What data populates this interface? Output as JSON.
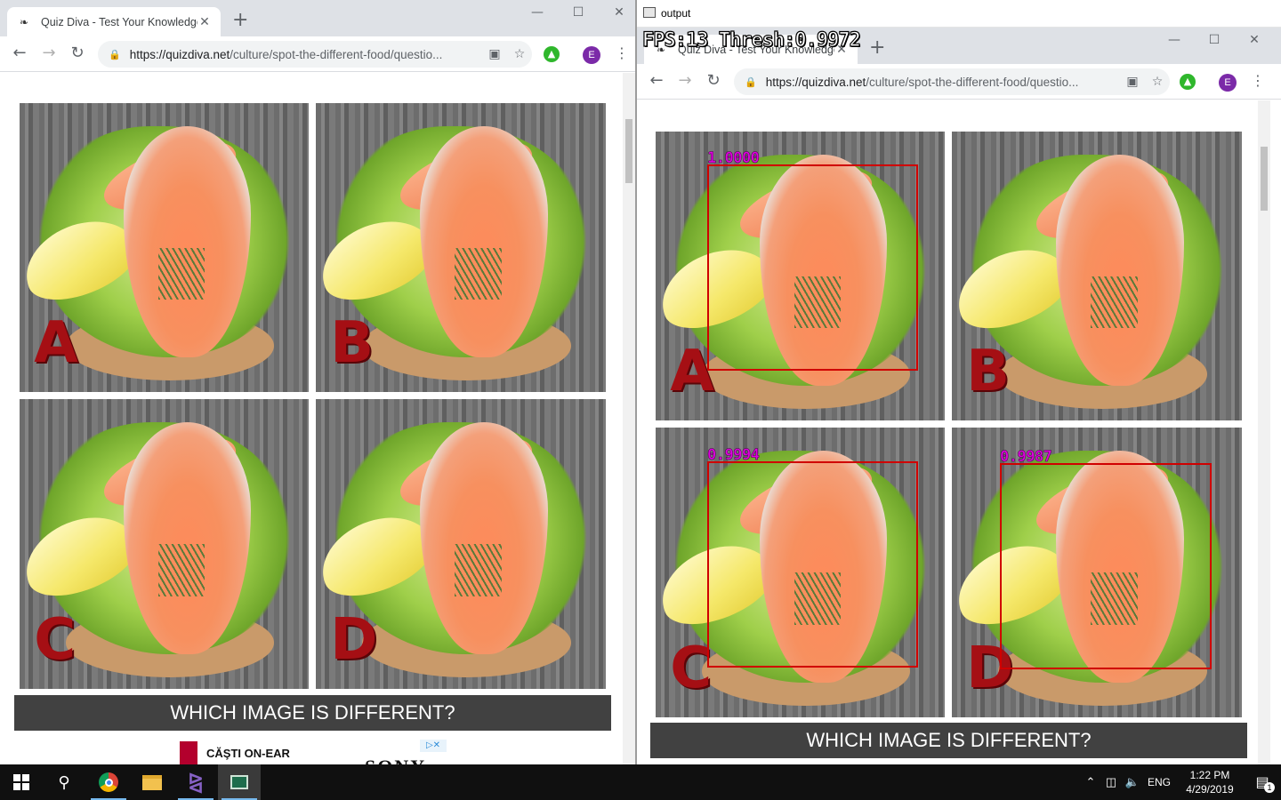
{
  "left_browser": {
    "tab_title": "Quiz Diva - Test Your Knowledge",
    "favicon": "quizdiva-icon",
    "url_host": "https://quizdiva.net",
    "url_path": "/culture/spot-the-different-food/questio...",
    "profile_initial": "E",
    "tiles": [
      {
        "letter": "A"
      },
      {
        "letter": "B"
      },
      {
        "letter": "C"
      },
      {
        "letter": "D"
      }
    ],
    "question": "WHICH IMAGE IS DIFFERENT?",
    "ad": {
      "label": "CĂŞTI ON-EAR",
      "brand_partial": "SONY"
    }
  },
  "output_window": {
    "title": "output",
    "hud": "FPS:13  Thresh:0.9972",
    "tab_title": "Quiz Diva - Test Your Knowledge",
    "url_host": "https://quizdiva.net",
    "url_path": "/culture/spot-the-different-food/questio...",
    "profile_initial": "E",
    "tiles": [
      {
        "letter": "A",
        "score": "1.0000"
      },
      {
        "letter": "B",
        "score": ""
      },
      {
        "letter": "C",
        "score": "0.9994"
      },
      {
        "letter": "D",
        "score": "0.9987"
      }
    ],
    "question": "WHICH IMAGE IS DIFFERENT?"
  },
  "taskbar": {
    "apps": [
      "start-icon",
      "search-icon",
      "chrome-icon",
      "file-explorer-icon",
      "visual-studio-icon",
      "output-window-icon"
    ],
    "language": "ENG",
    "time": "1:22 PM",
    "date": "4/29/2019",
    "notification_count": "1"
  },
  "colors": {
    "bbox": "#d00000",
    "score_text": "#e000e0",
    "question_bar": "#414141",
    "taskbar": "#101010"
  }
}
